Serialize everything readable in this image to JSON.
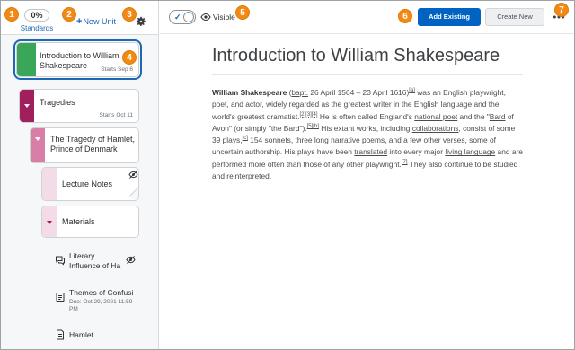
{
  "callouts": [
    "1",
    "2",
    "3",
    "4",
    "5",
    "6",
    "7"
  ],
  "left": {
    "standards_pct": "0%",
    "standards_label": "Standards",
    "new_unit_label": "New Unit",
    "cards": [
      {
        "title": "Introduction to William Shakespeare",
        "date": "Starts Sep 6",
        "color": "#3aa65a"
      },
      {
        "title": "Tragedies",
        "date": "Starts Oct 11",
        "color": "#a01f5c"
      },
      {
        "title": "The Tragedy of Hamlet, Prince of Denmark",
        "color": "#d97ea7"
      },
      {
        "title": "Lecture Notes",
        "color": "#f3dce7"
      },
      {
        "title": "Materials",
        "color": "#f3dce7"
      }
    ],
    "leaves": [
      {
        "title": "Literary Influence of Ha",
        "icon": "discussion-icon"
      },
      {
        "title": "Themes of Confusi",
        "date": "Due: Oct 29, 2021 11:59 PM",
        "icon": "assignment-icon"
      },
      {
        "title": "Hamlet",
        "icon": "document-icon"
      }
    ]
  },
  "toolbar": {
    "visible_label": "Visible",
    "add_existing": "Add Existing",
    "create_new": "Create New"
  },
  "content": {
    "title": "Introduction to William Shakespeare",
    "p": {
      "name": "William Shakespeare",
      "t1": " (",
      "bapt": "bapt.",
      "t2": " 26 April 1564 – 23 April 1616)",
      "ref_a": "[a]",
      "t3": " was an English playwright, poet, and actor, widely regarded as the greatest writer in the English language and the world's greatest dramatist.",
      "ref_234": "[2][3][4]",
      "t4": " He is often called England's ",
      "national_poet": "national poet",
      "t5": " and the \"",
      "bard": "Bard",
      "t6": " of Avon\" (or simply \"the Bard\").",
      "ref_5b": "[5][b]",
      "t7": " His extant works, including ",
      "collaborations": "collaborations",
      "t8": ", consist of some ",
      "plays": "39 plays",
      "t9": ",",
      "ref_c": "[c]",
      "t10": " ",
      "sonnets": "154 sonnets",
      "t11": ", three long ",
      "narrative_poems": "narrative poems",
      "t12": ", and a few other verses, some of uncertain authorship. His plays have been ",
      "translated": "translated",
      "t13": " into every major ",
      "living_language": "living language",
      "t14": " and are performed more often than those of any other playwright.",
      "ref_7": "[7]",
      "t15": " They also continue to be studied and reinterpreted."
    }
  },
  "colors": {
    "callout": "#f18a14",
    "primary": "#0063c1",
    "link": "#1d67b5"
  }
}
